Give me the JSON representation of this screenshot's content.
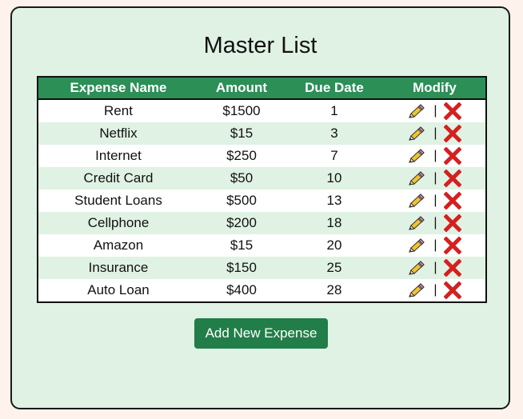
{
  "page": {
    "title": "Master List"
  },
  "table": {
    "headers": {
      "name": "Expense Name",
      "amount": "Amount",
      "due_date": "Due Date",
      "modify": "Modify"
    },
    "modify_separator": "|",
    "rows": [
      {
        "name": "Rent",
        "amount": "$1500",
        "due_date": "1"
      },
      {
        "name": "Netflix",
        "amount": "$15",
        "due_date": "3"
      },
      {
        "name": "Internet",
        "amount": "$250",
        "due_date": "7"
      },
      {
        "name": "Credit Card",
        "amount": "$50",
        "due_date": "10"
      },
      {
        "name": "Student Loans",
        "amount": "$500",
        "due_date": "13"
      },
      {
        "name": "Cellphone",
        "amount": "$200",
        "due_date": "18"
      },
      {
        "name": "Amazon",
        "amount": "$15",
        "due_date": "20"
      },
      {
        "name": "Insurance",
        "amount": "$150",
        "due_date": "25"
      },
      {
        "name": "Auto Loan",
        "amount": "$400",
        "due_date": "28"
      }
    ]
  },
  "actions": {
    "add_label": "Add New Expense",
    "edit_icon": "pencil-icon",
    "delete_icon": "red-x-icon"
  },
  "colors": {
    "page_background": "#fdf2ec",
    "card_background": "#e0f2e3",
    "header_background": "#2b8f56",
    "button_background": "#217e48",
    "delete_red": "#d42020"
  }
}
